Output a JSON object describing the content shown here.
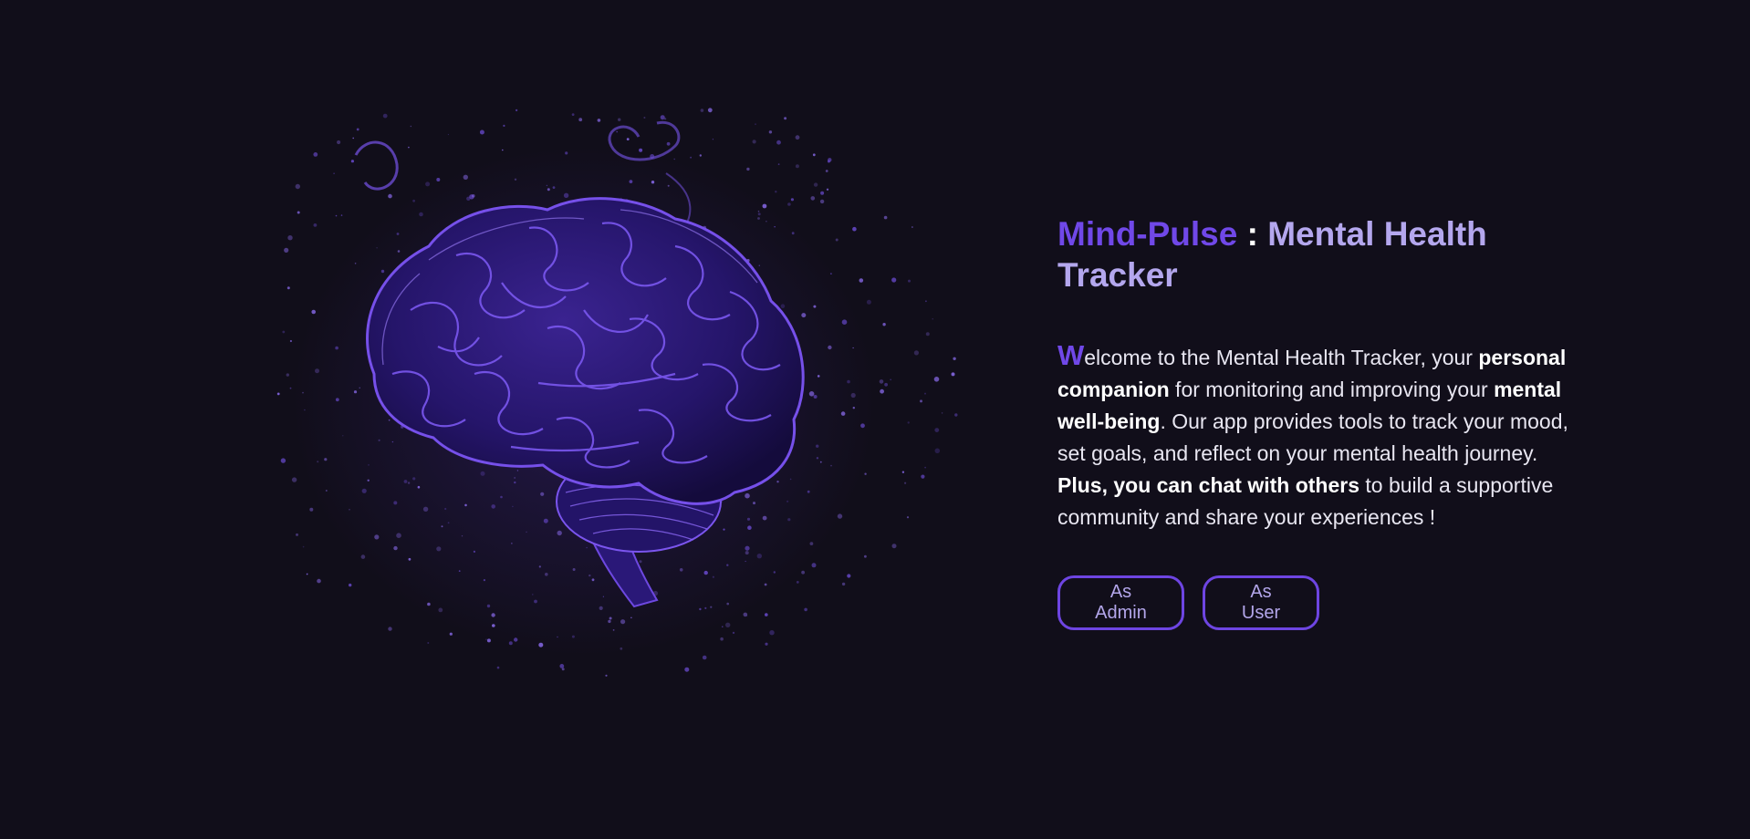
{
  "hero": {
    "image": "brain-illustration",
    "title_brand": "Mind-Pulse",
    "title_separator": " : ",
    "title_rest": "Mental Health Tracker",
    "intro": {
      "dropcap": "W",
      "part1": "elcome to the Mental Health Tracker, your ",
      "bold1": "personal companion",
      "part2": " for monitoring and improving your ",
      "bold2": "mental well-being",
      "part3": ". Our app provides tools to track your mood, set goals, and reflect on your mental health journey. ",
      "bold3": "Plus, you can chat with others",
      "part4": " to build a supportive community and share your experiences !"
    }
  },
  "actions": {
    "admin_label": "As Admin",
    "user_label": "As User"
  },
  "colors": {
    "background": "#110e1a",
    "accent": "#7048e8",
    "title": "#b4a7ee",
    "button_border": "#6e45e2"
  }
}
